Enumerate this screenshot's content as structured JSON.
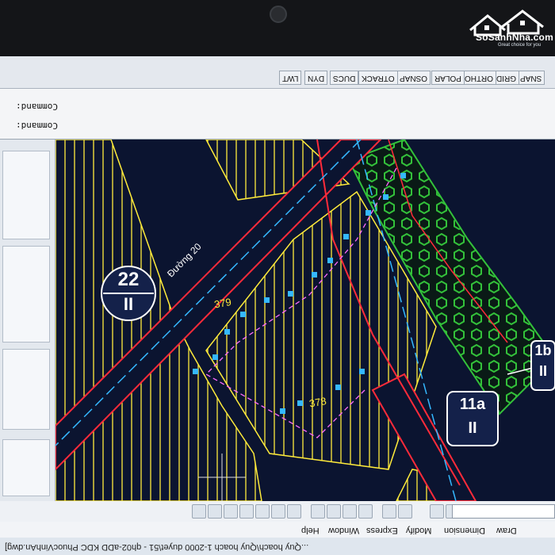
{
  "watermark": {
    "brand": "SoSanhNha.com",
    "tagline": "Great choice for you"
  },
  "window": {
    "title": "...Quy hoach\\Quy hoach 1-2000 duyet\\51 - qh02-aDD KDC PhuocVinhAn.dwg]"
  },
  "menu": [
    "Draw",
    "Dimension",
    "Modify",
    "Express",
    "Window",
    "Help"
  ],
  "command": {
    "line1": "Command:",
    "line2": "Command:"
  },
  "status": [
    "SNAP",
    "GRID",
    "ORTHO",
    "POLAR",
    "OSNAP",
    "OTRACK",
    "DUCS",
    "DYN",
    "LWT"
  ],
  "drawing": {
    "lots": [
      {
        "zone": "II",
        "number": "22"
      },
      {
        "zone": "II",
        "number": "11a"
      },
      {
        "zone": "II",
        "number": "1b"
      }
    ],
    "parcel_labels": [
      "379",
      "378"
    ],
    "road_label": "Đường 20"
  },
  "colors": {
    "background": "#0b1430",
    "hatch": "#ffeb3b",
    "road_red": "#ff2b3a",
    "green_zone": "#33c13a",
    "cyan": "#35b8ff",
    "magenta": "#ff6bff"
  }
}
